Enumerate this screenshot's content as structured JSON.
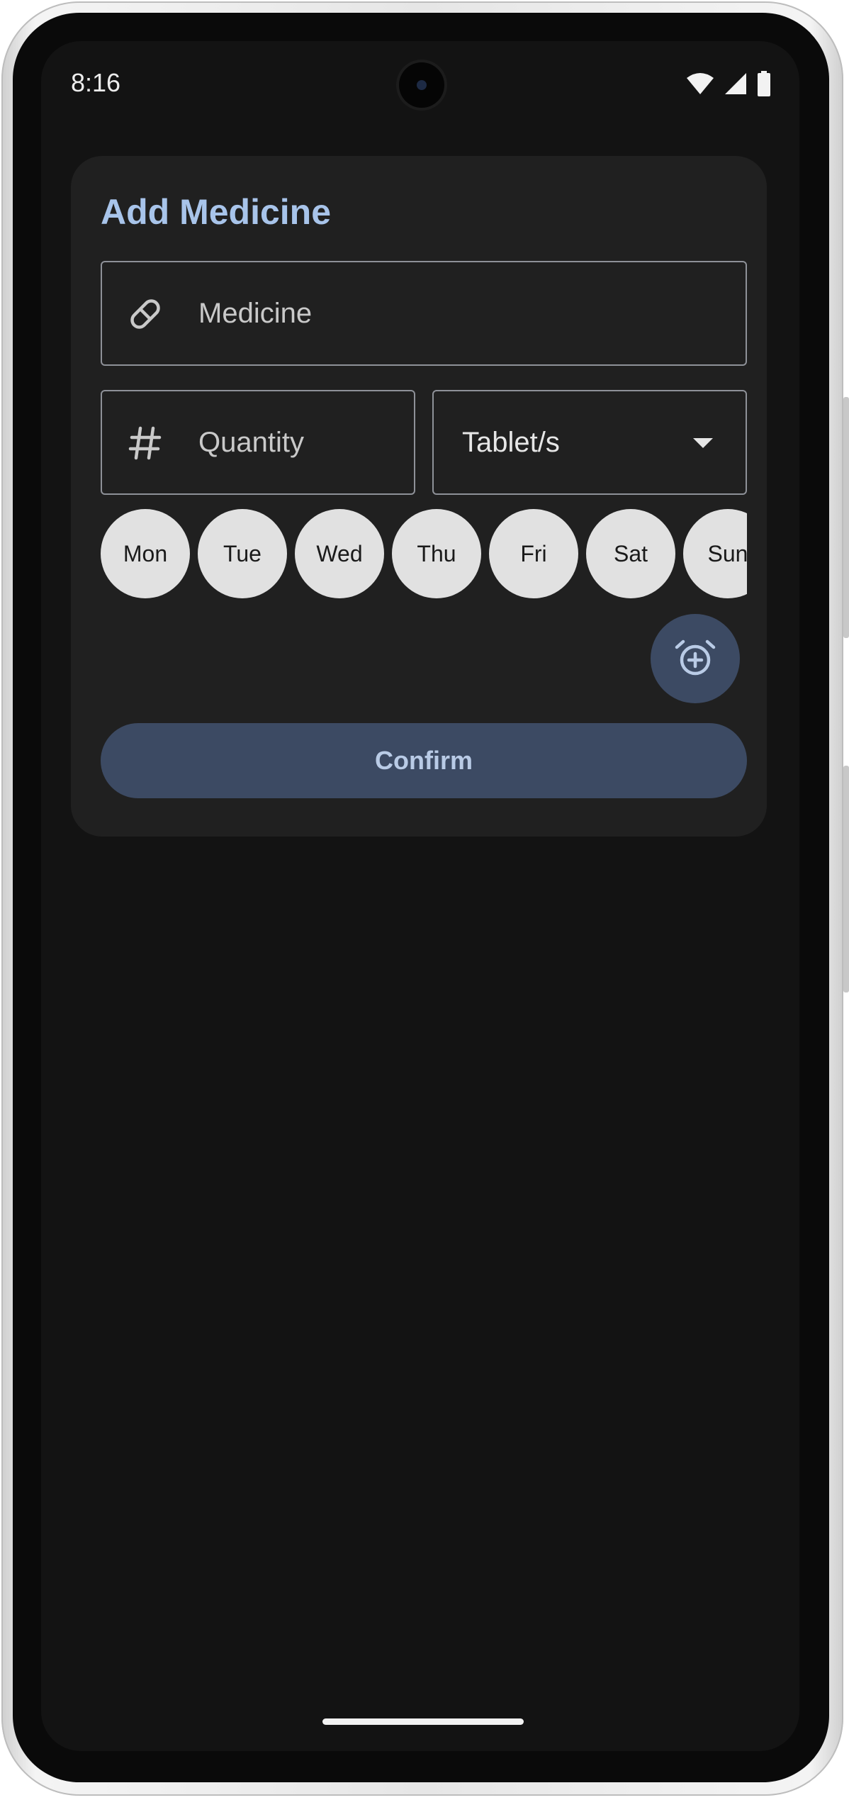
{
  "status_bar": {
    "time": "8:16",
    "icons": [
      "wifi-icon",
      "cell-signal-icon",
      "battery-icon"
    ]
  },
  "dialog": {
    "title": "Add Medicine",
    "medicine_field": {
      "placeholder": "Medicine",
      "icon": "pill-icon"
    },
    "quantity_field": {
      "placeholder": "Quantity",
      "icon": "hash-icon"
    },
    "unit_select": {
      "value": "Tablet/s"
    },
    "days": [
      "Mon",
      "Tue",
      "Wed",
      "Thu",
      "Fri",
      "Sat",
      "Sun"
    ],
    "add_alarm_icon": "alarm-add-icon",
    "confirm_label": "Confirm"
  },
  "colors": {
    "accent": "#a8c4ea",
    "screen_bg": "#131313",
    "card_bg": "#202020",
    "button_bg": "#3c4a63",
    "chip_bg": "#e1e1e1"
  }
}
